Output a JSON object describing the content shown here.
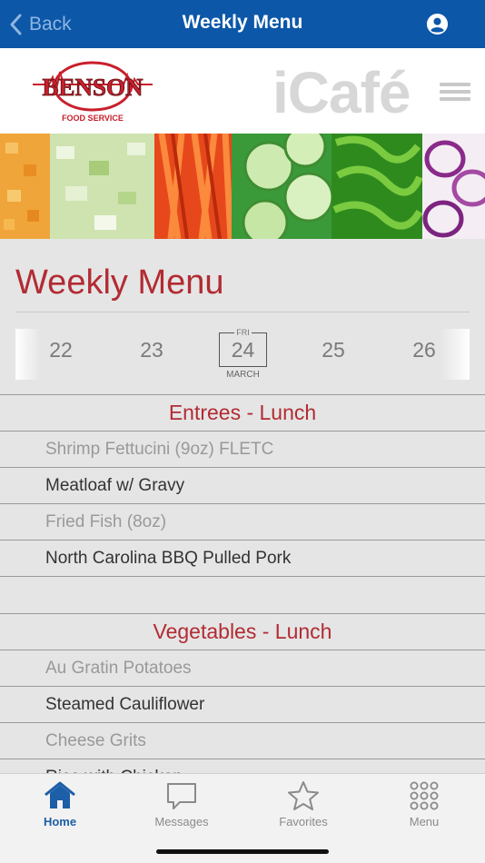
{
  "navbar": {
    "back_label": "Back",
    "title": "Weekly Menu",
    "account_icon": "account-circle-icon"
  },
  "brand": {
    "logo_name": "BENSON",
    "logo_sub": "FOOD SERVICE",
    "app_name": "iCafé"
  },
  "page": {
    "heading": "Weekly Menu"
  },
  "dates": {
    "days": [
      "22",
      "23",
      "25",
      "26"
    ],
    "selected": {
      "dow": "FRI",
      "day": "24",
      "month": "MARCH"
    }
  },
  "sections": [
    {
      "title": "Entrees - Lunch",
      "items": [
        {
          "name": "Shrimp Fettucini (9oz) FLETC",
          "style": "light"
        },
        {
          "name": "Meatloaf w/ Gravy",
          "style": "dark"
        },
        {
          "name": "Fried Fish (8oz)",
          "style": "light"
        },
        {
          "name": "North Carolina BBQ Pulled Pork",
          "style": "dark"
        }
      ]
    },
    {
      "title": "Vegetables - Lunch",
      "items": [
        {
          "name": "Au Gratin Potatoes",
          "style": "light"
        },
        {
          "name": "Steamed Cauliflower",
          "style": "dark"
        },
        {
          "name": "Cheese Grits",
          "style": "light"
        },
        {
          "name": "Rice with Chicken",
          "style": "dark"
        }
      ]
    }
  ],
  "tabs": [
    {
      "label": "Home",
      "icon": "home-icon",
      "active": true
    },
    {
      "label": "Messages",
      "icon": "message-icon",
      "active": false
    },
    {
      "label": "Favorites",
      "icon": "star-icon",
      "active": false
    },
    {
      "label": "Menu",
      "icon": "grid-menu-icon",
      "active": false
    }
  ],
  "colors": {
    "nav": "#0c57a8",
    "accent": "#b22b33",
    "active_tab": "#1d5ea8"
  }
}
